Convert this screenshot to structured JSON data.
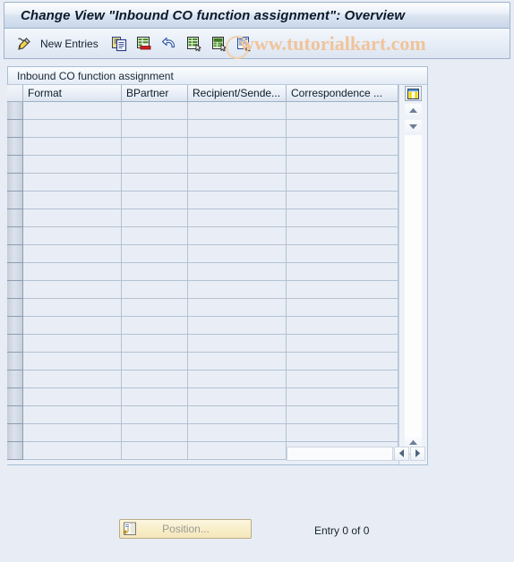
{
  "window": {
    "title": "Change View \"Inbound CO function assignment\": Overview"
  },
  "toolbar": {
    "new_entries_label": "New Entries",
    "icons": [
      {
        "name": "edit-pencil-icon",
        "title": "Display/Change"
      },
      {
        "name": "copy-icon",
        "title": "Copy As..."
      },
      {
        "name": "delete-icon",
        "title": "Delete"
      },
      {
        "name": "undo-icon",
        "title": "Undo Change"
      },
      {
        "name": "select-all-icon",
        "title": "Select All"
      },
      {
        "name": "deselect-all-icon",
        "title": "Deselect All"
      },
      {
        "name": "details-icon",
        "title": "Details"
      }
    ]
  },
  "watermark": {
    "text": "www.tutorialkart.com"
  },
  "panel": {
    "caption": "Inbound CO function assignment"
  },
  "table": {
    "columns": [
      {
        "label": "Format",
        "key": "format"
      },
      {
        "label": "BPartner",
        "key": "bpartner"
      },
      {
        "label": "Recipient/Sende...",
        "key": "recipient_sender"
      },
      {
        "label": "Correspondence ...",
        "key": "correspondence"
      }
    ],
    "rows": [],
    "empty_row_count": 20,
    "config_icon": "column-config-icon",
    "scroll_up_icon": "scroll-up-icon",
    "scroll_down_icon": "scroll-down-icon",
    "scroll_left_icon": "scroll-left-icon",
    "scroll_right_icon": "scroll-right-icon"
  },
  "footer": {
    "position_button_label": "Position...",
    "position_button_icon": "position-goto-icon",
    "entry_status": "Entry 0 of 0"
  },
  "colors": {
    "page_background": "#e8edf5",
    "title_border": "#9fb4cc",
    "grid_line": "#b3c1d2",
    "row_selector": "#c8d1dd",
    "watermark": "#f0c49a",
    "button_yellow": "#f8eec9"
  }
}
